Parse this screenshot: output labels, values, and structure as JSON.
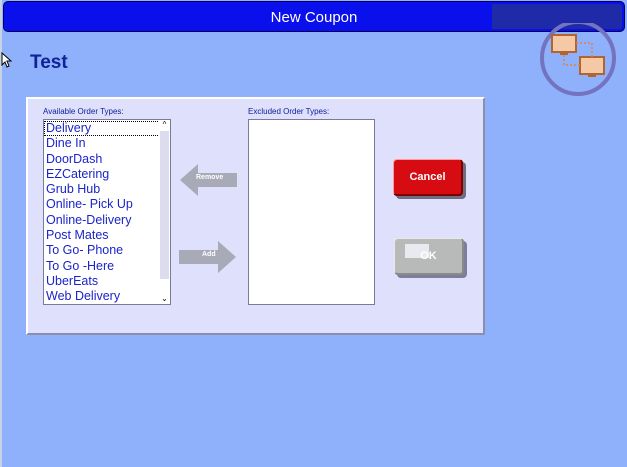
{
  "window": {
    "title": "New Coupon"
  },
  "coupon": {
    "name": "Test"
  },
  "available": {
    "label": "Available Order Types:",
    "items": [
      "Delivery",
      "Dine In",
      "DoorDash",
      "EZCatering",
      "Grub Hub",
      "Online- Pick Up",
      "Online-Delivery",
      "Post Mates",
      "To Go- Phone",
      "To Go -Here",
      "UberEats",
      "Web Delivery"
    ]
  },
  "excluded": {
    "label": "Excluded Order Types:",
    "items": []
  },
  "buttons": {
    "remove": "Remove",
    "add": "Add",
    "cancel": "Cancel",
    "ok": "OK"
  },
  "colors": {
    "title_bar": "#0a10ec",
    "background": "#8fb0fb",
    "panel": "#dfe0fb",
    "cancel": "#d60c12",
    "list_text": "#1b24c8"
  },
  "icons": {
    "logo": "network-computers-icon",
    "remove": "arrow-left-icon",
    "add": "arrow-right-icon"
  }
}
